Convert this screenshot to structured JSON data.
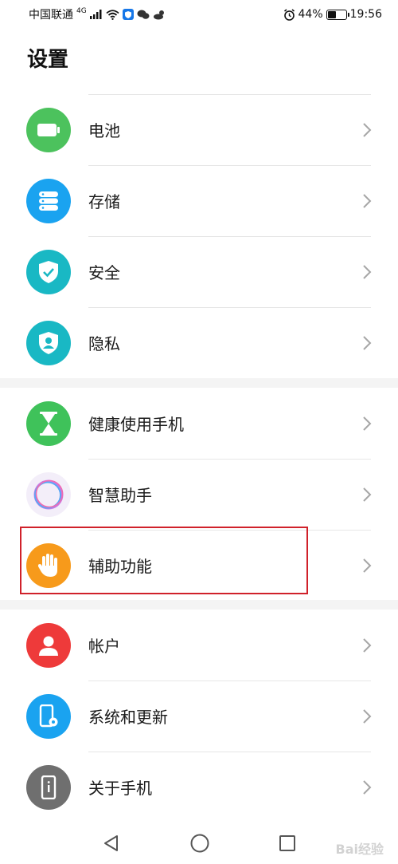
{
  "status_bar": {
    "carrier": "中国联通",
    "network": "4G",
    "battery_percent": "44%",
    "battery_level": 0.44,
    "time": "19:56"
  },
  "page": {
    "title": "设置"
  },
  "groups": [
    {
      "items": [
        {
          "label": "电池",
          "icon": "battery-icon",
          "color": "#4cc25d"
        },
        {
          "label": "存储",
          "icon": "storage-icon",
          "color": "#1aa3f0"
        },
        {
          "label": "安全",
          "icon": "shield-check-icon",
          "color": "#19b8c4"
        },
        {
          "label": "隐私",
          "icon": "privacy-icon",
          "color": "#19b8c4"
        }
      ]
    },
    {
      "items": [
        {
          "label": "健康使用手机",
          "icon": "hourglass-icon",
          "color": "#3fc25a"
        },
        {
          "label": "智慧助手",
          "icon": "assistant-ring-icon",
          "color": "#f3eef9"
        },
        {
          "label": "辅助功能",
          "icon": "hand-icon",
          "color": "#f79a1b"
        }
      ]
    },
    {
      "items": [
        {
          "label": "帐户",
          "icon": "account-icon",
          "color": "#ee3a3a"
        },
        {
          "label": "系统和更新",
          "icon": "system-update-icon",
          "color": "#1aa3f0"
        },
        {
          "label": "关于手机",
          "icon": "phone-info-icon",
          "color": "#6f6f6f"
        }
      ]
    }
  ],
  "highlight_color": "#d0212a",
  "nav": {
    "back": "back-icon",
    "home": "home-icon",
    "recents": "recents-icon"
  },
  "watermark": "Bai经验"
}
